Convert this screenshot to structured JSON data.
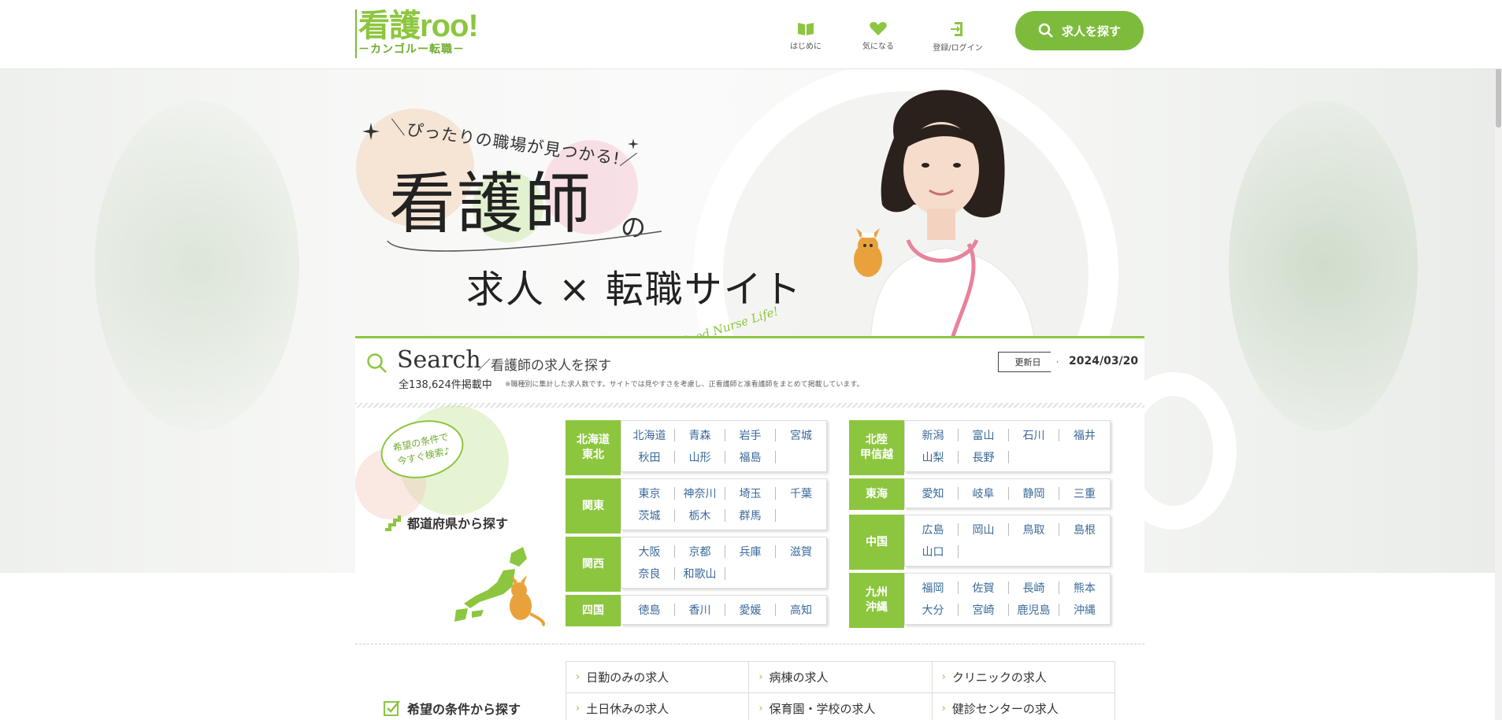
{
  "header": {
    "logo_main": "看護roo!",
    "logo_sub": "－カンゴルー転職－",
    "nav": [
      {
        "label": "はじめに",
        "icon": "book-icon"
      },
      {
        "label": "気になる",
        "icon": "heart-icon"
      },
      {
        "label": "登録/ログイン",
        "icon": "login-icon"
      }
    ],
    "search_button": "求人を探す"
  },
  "hero": {
    "catch": "＼ぴったりの職場が見つかる!／",
    "title": "看護師",
    "title_no": "の",
    "subtitle": "求人 × 転職サイト",
    "tagline": "Good Nurse Life!"
  },
  "search": {
    "heading": "Search",
    "subheading": "／看護師の求人を探す",
    "count": "全138,624件掲載中",
    "note": "※職種別に集計した求人数です。サイトでは見やすさを考慮し、正看護師と准看護師をまとめて掲載しています。",
    "update_label": "更新日",
    "update_date": "2024/03/20",
    "bubble": "希望の条件で\n今すぐ検索♪",
    "pref_heading": "都道府県から探す",
    "cond_heading": "希望の条件から探す"
  },
  "regions_left": [
    {
      "label": "北海道\n東北",
      "prefs": [
        "北海道",
        "青森",
        "岩手",
        "宮城",
        "秋田",
        "山形",
        "福島"
      ]
    },
    {
      "label": "関東",
      "prefs": [
        "東京",
        "神奈川",
        "埼玉",
        "千葉",
        "茨城",
        "栃木",
        "群馬"
      ]
    },
    {
      "label": "関西",
      "prefs": [
        "大阪",
        "京都",
        "兵庫",
        "滋賀",
        "奈良",
        "和歌山"
      ]
    },
    {
      "label": "四国",
      "prefs": [
        "徳島",
        "香川",
        "愛媛",
        "高知"
      ]
    }
  ],
  "regions_right": [
    {
      "label": "北陸\n甲信越",
      "prefs": [
        "新潟",
        "富山",
        "石川",
        "福井",
        "山梨",
        "長野"
      ]
    },
    {
      "label": "東海",
      "prefs": [
        "愛知",
        "岐阜",
        "静岡",
        "三重"
      ]
    },
    {
      "label": "中国",
      "prefs": [
        "広島",
        "岡山",
        "鳥取",
        "島根",
        "山口"
      ]
    },
    {
      "label": "九州\n沖縄",
      "prefs": [
        "福岡",
        "佐賀",
        "長崎",
        "熊本",
        "大分",
        "宮崎",
        "鹿児島",
        "沖縄"
      ]
    }
  ],
  "conditions": [
    "日勤のみの求人",
    "病棟の求人",
    "クリニックの求人",
    "土日休みの求人",
    "保育園・学校の求人",
    "健診センターの求人"
  ],
  "colors": {
    "accent": "#8cc63f",
    "link": "#3a6a9b"
  }
}
